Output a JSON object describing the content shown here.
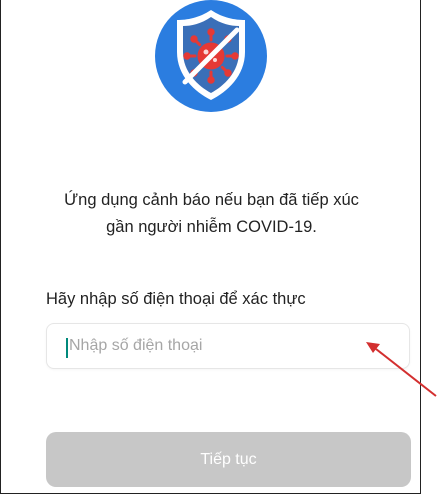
{
  "app": {
    "icon": "shield-virus-icon",
    "description_line1": "Ứng dụng cảnh báo nếu bạn đã tiếp xúc",
    "description_line2": "gần người nhiễm COVID-19."
  },
  "form": {
    "phone_label": "Hãy nhập số điện thoại để xác thực",
    "phone_value": "",
    "phone_placeholder": "Nhập số điện thoại",
    "continue_label": "Tiếp tục",
    "continue_enabled": false
  },
  "annotation": {
    "icon": "red-arrow-icon"
  },
  "colors": {
    "logo_circle": "#2b7de0",
    "shield": "#ffffff",
    "shield_inner": "#3a6fb8",
    "virus": "#e53935",
    "caret": "#00897b",
    "button_disabled": "#c7c7c7",
    "annotation_arrow": "#d32f2f"
  }
}
